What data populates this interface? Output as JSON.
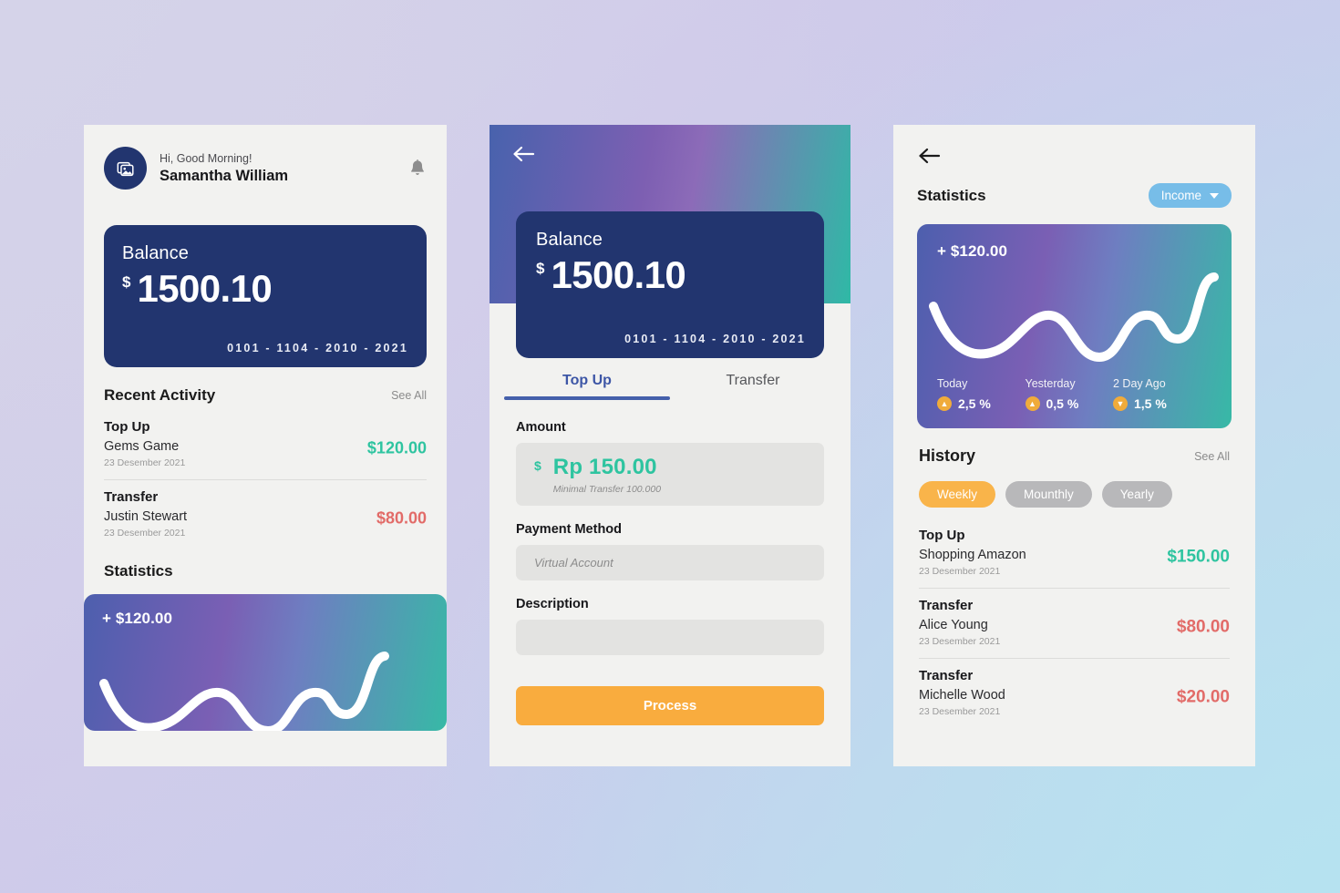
{
  "screen1": {
    "header": {
      "avatar_icon": "image-placeholder-icon",
      "greeting": "Hi, Good Morning!",
      "user_name": "Samantha William",
      "notification_icon": "bell-icon"
    },
    "balance_card": {
      "label": "Balance",
      "currency": "$",
      "amount": "1500.10",
      "card_number": "0101 - 1104 - 2010 - 2021"
    },
    "recent_activity": {
      "title": "Recent Activity",
      "see_all": "See All",
      "items": [
        {
          "type": "Top Up",
          "name": "Gems Game",
          "date": "23 Desember 2021",
          "amount": "$120.00",
          "direction": "in"
        },
        {
          "type": "Transfer",
          "name": "Justin Stewart",
          "date": "23 Desember 2021",
          "amount": "$80.00",
          "direction": "out"
        }
      ]
    },
    "statistics": {
      "title": "Statistics",
      "amount": "+ $120.00"
    }
  },
  "screen2": {
    "back_icon": "arrow-left-icon",
    "balance_card": {
      "label": "Balance",
      "currency": "$",
      "amount": "1500.10",
      "card_number": "0101 - 1104 - 2010 - 2021"
    },
    "tabs": [
      {
        "label": "Top Up",
        "active": true
      },
      {
        "label": "Transfer",
        "active": false
      }
    ],
    "form": {
      "amount_label": "Amount",
      "amount_currency": "$",
      "amount_value": "Rp 150.00",
      "amount_hint": "Minimal Transfer 100.000",
      "payment_label": "Payment Method",
      "payment_placeholder": "Virtual Account",
      "description_label": "Description",
      "description_value": ""
    },
    "process_button": "Process"
  },
  "screen3": {
    "back_icon": "arrow-left-icon",
    "title": "Statistics",
    "filter": {
      "label": "Income",
      "icon": "chevron-down-icon"
    },
    "stat_card": {
      "amount": "+ $120.00",
      "legend": [
        {
          "label": "Today",
          "value": "2,5 %",
          "direction": "up"
        },
        {
          "label": "Yesterday",
          "value": "0,5 %",
          "direction": "up"
        },
        {
          "label": "2 Day Ago",
          "value": "1,5 %",
          "direction": "down"
        }
      ]
    },
    "history": {
      "title": "History",
      "see_all": "See All",
      "pills": [
        {
          "label": "Weekly",
          "active": true
        },
        {
          "label": "Mounthly",
          "active": false
        },
        {
          "label": "Yearly",
          "active": false
        }
      ],
      "items": [
        {
          "type": "Top Up",
          "name": "Shopping Amazon",
          "date": "23 Desember 2021",
          "amount": "$150.00",
          "direction": "in"
        },
        {
          "type": "Transfer",
          "name": "Alice Young",
          "date": "23 Desember 2021",
          "amount": "$80.00",
          "direction": "out"
        },
        {
          "type": "Transfer",
          "name": "Michelle Wood",
          "date": "23 Desember 2021",
          "amount": "$20.00",
          "direction": "out"
        }
      ]
    }
  },
  "colors": {
    "card_navy": "#22356f",
    "income_green": "#2ec4a0",
    "expense_red": "#e26b68",
    "accent_orange": "#f9ac3e",
    "tab_blue": "#4560ab",
    "pill_blue": "#77bde8"
  }
}
